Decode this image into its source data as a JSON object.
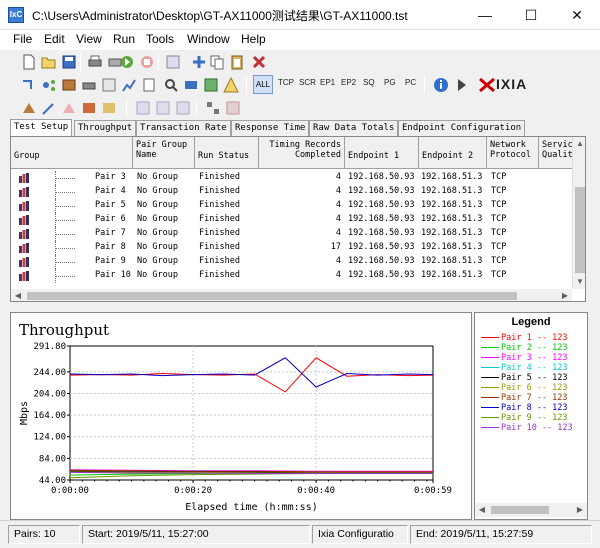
{
  "window": {
    "title": "C:\\Users\\Administrator\\Desktop\\GT-AX11000测试结果\\GT-AX11000.tst",
    "minimize": "—",
    "maximize": "☐",
    "close": "✕",
    "icon": "ixchariot-app-icon"
  },
  "menu": [
    "File",
    "Edit",
    "View",
    "Run",
    "Tools",
    "Window",
    "Help"
  ],
  "menu_accel": [
    "F",
    "E",
    "V",
    "R",
    "T",
    "W",
    "H"
  ],
  "toolbar2": {
    "text_buttons": [
      "ALL",
      "TCP",
      "SCR",
      "EP1",
      "EP2",
      "SQ",
      "PG",
      "PC"
    ],
    "brand": "IXIA"
  },
  "tabs": [
    "Test Setup",
    "Throughput",
    "Transaction Rate",
    "Response Time",
    "Raw Data Totals",
    "Endpoint Configuration"
  ],
  "grid": {
    "headers": [
      "Group",
      "Pair Group Name",
      "Run Status",
      "Timing Records Completed",
      "Endpoint 1",
      "Endpoint 2",
      "Network Protocol",
      "Service Quality"
    ],
    "header_lines": [
      [
        "Group"
      ],
      [
        "Pair Group",
        "Name"
      ],
      [
        "Run Status"
      ],
      [
        "Timing Records",
        "Completed"
      ],
      [
        "Endpoint 1"
      ],
      [
        "Endpoint 2"
      ],
      [
        "Network",
        "Protocol"
      ],
      [
        "Servic",
        "Qualit"
      ]
    ],
    "rows": [
      {
        "pair": "Pair 3",
        "group": "No Group",
        "status": "Finished",
        "records": "4",
        "ep1": "192.168.50.93",
        "ep2": "192.168.51.3",
        "protocol": "TCP"
      },
      {
        "pair": "Pair 4",
        "group": "No Group",
        "status": "Finished",
        "records": "4",
        "ep1": "192.168.50.93",
        "ep2": "192.168.51.3",
        "protocol": "TCP"
      },
      {
        "pair": "Pair 5",
        "group": "No Group",
        "status": "Finished",
        "records": "4",
        "ep1": "192.168.50.93",
        "ep2": "192.168.51.3",
        "protocol": "TCP"
      },
      {
        "pair": "Pair 6",
        "group": "No Group",
        "status": "Finished",
        "records": "4",
        "ep1": "192.168.50.93",
        "ep2": "192.168.51.3",
        "protocol": "TCP"
      },
      {
        "pair": "Pair 7",
        "group": "No Group",
        "status": "Finished",
        "records": "4",
        "ep1": "192.168.50.93",
        "ep2": "192.168.51.3",
        "protocol": "TCP"
      },
      {
        "pair": "Pair 8",
        "group": "No Group",
        "status": "Finished",
        "records": "17",
        "ep1": "192.168.50.93",
        "ep2": "192.168.51.3",
        "protocol": "TCP"
      },
      {
        "pair": "Pair 9",
        "group": "No Group",
        "status": "Finished",
        "records": "4",
        "ep1": "192.168.50.93",
        "ep2": "192.168.51.3",
        "protocol": "TCP"
      },
      {
        "pair": "Pair 10",
        "group": "No Group",
        "status": "Finished",
        "records": "4",
        "ep1": "192.168.50.93",
        "ep2": "192.168.51.3",
        "protocol": "TCP"
      }
    ]
  },
  "chart_data": {
    "type": "line",
    "title": "Throughput",
    "xlabel": "Elapsed time (h:mm:ss)",
    "ylabel": "Mbps",
    "x_ticks": [
      "0:00:00",
      "0:00:20",
      "0:00:40",
      "0:00:59"
    ],
    "x_tick_seconds": [
      0,
      20,
      40,
      59
    ],
    "xlim": [
      0,
      59
    ],
    "y_ticks": [
      "291.80",
      "244.00",
      "204.00",
      "164.00",
      "124.00",
      "84.00",
      "44.00"
    ],
    "y_tick_values": [
      291.8,
      244,
      204,
      164,
      124,
      84,
      44
    ],
    "ylim": [
      44,
      291.8
    ],
    "grid": true,
    "legend_position": "right",
    "series": [
      {
        "name": "Pair 1 -- 123",
        "color": "#ff0000",
        "x": [
          0,
          5,
          10,
          15,
          20,
          25,
          30,
          35,
          40,
          45,
          50,
          55,
          59
        ],
        "y": [
          238,
          239,
          238,
          241,
          239,
          238,
          240,
          207,
          270,
          236,
          239,
          237,
          238
        ]
      },
      {
        "name": "Pair 2 -- 123",
        "color": "#00cc00",
        "x": [
          0,
          10,
          20,
          30,
          40,
          50,
          59
        ],
        "y": [
          53,
          55,
          56,
          57,
          57,
          58,
          58
        ]
      },
      {
        "name": "Pair 3 -- 123",
        "color": "#ff00ff",
        "x": [
          0,
          10,
          20,
          30,
          40,
          50,
          59
        ],
        "y": [
          63,
          62,
          61,
          61,
          60,
          60,
          60
        ]
      },
      {
        "name": "Pair 4 -- 123",
        "color": "#00cccc",
        "x": [
          0,
          10,
          20,
          30,
          40,
          50,
          59
        ],
        "y": [
          61,
          60,
          60,
          59,
          59,
          58,
          58
        ]
      },
      {
        "name": "Pair 5 -- 123",
        "color": "#000000",
        "x": [
          0,
          10,
          20,
          30,
          40,
          50,
          59
        ],
        "y": [
          60,
          60,
          59,
          59,
          58,
          58,
          58
        ]
      },
      {
        "name": "Pair 6 -- 123",
        "color": "#999900",
        "x": [
          0,
          10,
          20,
          30,
          40,
          50,
          59
        ],
        "y": [
          59,
          58,
          58,
          57,
          57,
          57,
          57
        ]
      },
      {
        "name": "Pair 7 -- 123",
        "color": "#993300",
        "x": [
          0,
          10,
          20,
          30,
          40,
          50,
          59
        ],
        "y": [
          62,
          61,
          60,
          60,
          59,
          59,
          59
        ]
      },
      {
        "name": "Pair 8 -- 123",
        "color": "#0000cc",
        "x": [
          0,
          5,
          10,
          15,
          20,
          25,
          30,
          35,
          40,
          45,
          50,
          55,
          59
        ],
        "y": [
          240,
          239,
          240,
          237,
          239,
          240,
          238,
          270,
          216,
          241,
          238,
          240,
          239
        ]
      },
      {
        "name": "Pair 9 -- 123",
        "color": "#669900",
        "x": [
          0,
          10,
          20,
          30,
          40,
          50,
          59
        ],
        "y": [
          48,
          52,
          54,
          55,
          56,
          57,
          57
        ]
      },
      {
        "name": "Pair 10 -- 123",
        "color": "#9933cc",
        "x": [
          0,
          10,
          20,
          30,
          40,
          50,
          59
        ],
        "y": [
          58,
          57,
          57,
          56,
          56,
          56,
          56
        ]
      }
    ]
  },
  "status": {
    "pairs": "Pairs: 10",
    "start": "Start: 2019/5/11, 15:27:00",
    "config": "Ixia Configuratio",
    "end": "End: 2019/5/11, 15:27:59"
  },
  "colors": {
    "window_bg": "#f0f0f0",
    "grid_header_bg": "#f0f0f0",
    "accent": "#3a7bd5",
    "ixia_red": "#cc0000"
  },
  "icons": [
    "new-icon",
    "open-icon",
    "save-icon",
    "print-icon",
    "run-icon",
    "stop-icon",
    "edit-icon",
    "add-pair-icon",
    "copy-icon",
    "paste-icon",
    "delete-icon",
    "info-icon",
    "ixia-logo-icon"
  ]
}
